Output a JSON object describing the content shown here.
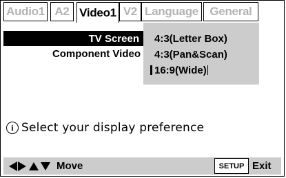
{
  "tabs": [
    {
      "label": "Audio1",
      "state": "inactive"
    },
    {
      "label": "A2",
      "state": "inactive"
    },
    {
      "label": "Video1",
      "state": "active"
    },
    {
      "label": "V2",
      "state": "inactive"
    },
    {
      "label": "Language",
      "state": "inactive"
    },
    {
      "label": "General",
      "state": "inactive"
    }
  ],
  "menu": {
    "items": [
      {
        "label": "TV Screen",
        "selected": true
      },
      {
        "label": "Component Video",
        "selected": false
      }
    ]
  },
  "options": [
    {
      "label": "4:3(Letter Box)"
    },
    {
      "label": "4:3(Pan&Scan)"
    },
    {
      "label": "16:9(Wide)",
      "current": true
    }
  ],
  "info": {
    "icon": "info-icon",
    "text": "Select your display preference"
  },
  "footer": {
    "arrow_icons": [
      "left-arrow-icon",
      "right-arrow-icon",
      "up-arrow-icon",
      "down-arrow-icon"
    ],
    "move_label": "Move",
    "setup_label": "SETUP",
    "exit_label": "Exit"
  },
  "colors": {
    "inactive_tab_text": "#b3b3b3",
    "panel_gray": "#cccccc",
    "selection_bg": "#000000"
  }
}
